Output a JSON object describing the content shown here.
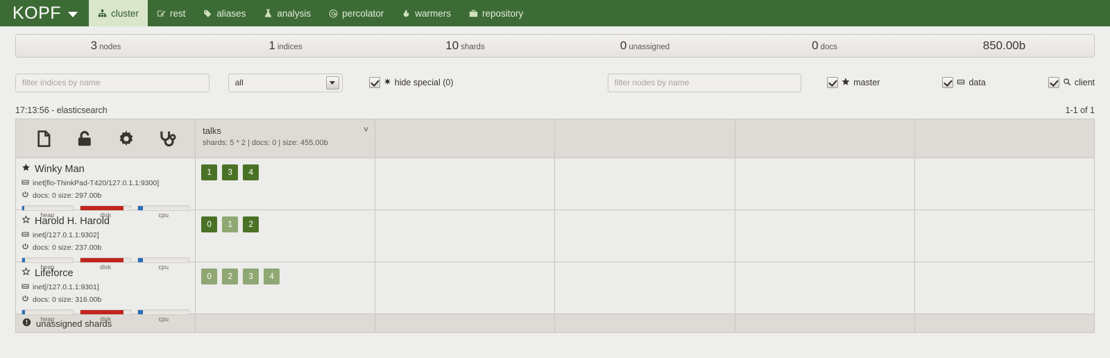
{
  "navbar": {
    "brand": "KOPF",
    "tabs": [
      {
        "label": "cluster",
        "icon": "sitemap-icon",
        "active": true
      },
      {
        "label": "rest",
        "icon": "edit-square-icon",
        "active": false
      },
      {
        "label": "aliases",
        "icon": "tag-icon",
        "active": false
      },
      {
        "label": "analysis",
        "icon": "flask-icon",
        "active": false
      },
      {
        "label": "percolator",
        "icon": "at-icon",
        "active": false
      },
      {
        "label": "warmers",
        "icon": "fire-icon",
        "active": false
      },
      {
        "label": "repository",
        "icon": "briefcase-icon",
        "active": false
      }
    ]
  },
  "stats": [
    {
      "num": "3",
      "label": "nodes"
    },
    {
      "num": "1",
      "label": "indices"
    },
    {
      "num": "10",
      "label": "shards"
    },
    {
      "num": "0",
      "label": "unassigned"
    },
    {
      "num": "0",
      "label": "docs"
    },
    {
      "num": "850.00b",
      "label": ""
    }
  ],
  "filters": {
    "index_filter_placeholder": "filter indices by name",
    "index_filter_value": "",
    "state_select_value": "all",
    "state_select_options": [
      "all"
    ],
    "hide_special": {
      "label": "hide special (0)",
      "checked": true,
      "icon": "asterisk-icon"
    },
    "node_filter_placeholder": "filter nodes by name",
    "node_filter_value": "",
    "node_toggles": [
      {
        "label": "master",
        "icon": "star-outline-icon",
        "checked": true
      },
      {
        "label": "data",
        "icon": "database-icon",
        "checked": true
      },
      {
        "label": "client",
        "icon": "magnifier-icon",
        "checked": true
      }
    ]
  },
  "meta": {
    "cluster_line": "17:13:56 - elasticsearch",
    "pagination": "1-1 of 1"
  },
  "header_actions": [
    {
      "name": "new-index-icon",
      "title": "create index"
    },
    {
      "name": "unlock-icon",
      "title": "index locks"
    },
    {
      "name": "gear-icon",
      "title": "cluster settings"
    },
    {
      "name": "stethoscope-icon",
      "title": "cluster health"
    }
  ],
  "indices": [
    {
      "name": "talks",
      "details": "shards: 5 * 2 | docs: 0 | size: 455.00b",
      "chevron": "chevron-down-icon"
    }
  ],
  "blank_columns": 4,
  "colors": {
    "nav_green": "#3d6b35",
    "active_tab_bg": "#d9e6cc",
    "shard_primary": "#4a7226",
    "shard_replica": "#8fa772",
    "bar_blue": "#2a6ebb",
    "bar_red": "#c0261d"
  },
  "nodes": [
    {
      "name": "Winky Man",
      "role_icon": "star-filled-icon",
      "transport": "inet[flo-ThinkPad-T420/127.0.1.1:9300]",
      "docs_size": "docs: 0  size: 297.00b",
      "bars": [
        {
          "label": "heap",
          "pct": 4,
          "color": "#2a6ebb"
        },
        {
          "label": "disk",
          "pct": 85,
          "color": "#c0261d"
        },
        {
          "label": "cpu",
          "pct": 9,
          "color": "#2a6ebb"
        }
      ],
      "shards": [
        {
          "num": "1",
          "type": "primary"
        },
        {
          "num": "3",
          "type": "primary"
        },
        {
          "num": "4",
          "type": "primary"
        }
      ]
    },
    {
      "name": "Harold H. Harold",
      "role_icon": "star-outline-icon",
      "transport": "inet[/127.0.1.1:9302]",
      "docs_size": "docs: 0  size: 237.00b",
      "bars": [
        {
          "label": "heap",
          "pct": 6,
          "color": "#2a6ebb"
        },
        {
          "label": "disk",
          "pct": 85,
          "color": "#c0261d"
        },
        {
          "label": "cpu",
          "pct": 9,
          "color": "#2a6ebb"
        }
      ],
      "shards": [
        {
          "num": "0",
          "type": "primary"
        },
        {
          "num": "1",
          "type": "replica"
        },
        {
          "num": "2",
          "type": "primary"
        }
      ]
    },
    {
      "name": "Lifeforce",
      "role_icon": "star-outline-icon",
      "transport": "inet[/127.0.1.1:9301]",
      "docs_size": "docs: 0  size: 316.00b",
      "bars": [
        {
          "label": "heap",
          "pct": 6,
          "color": "#2a6ebb"
        },
        {
          "label": "disk",
          "pct": 85,
          "color": "#c0261d"
        },
        {
          "label": "cpu",
          "pct": 9,
          "color": "#2a6ebb"
        }
      ],
      "shards": [
        {
          "num": "0",
          "type": "replica"
        },
        {
          "num": "2",
          "type": "replica"
        },
        {
          "num": "3",
          "type": "replica"
        },
        {
          "num": "4",
          "type": "replica"
        }
      ]
    }
  ],
  "unassigned": {
    "label": "unassigned shards",
    "icon": "exclamation-circle-icon"
  }
}
